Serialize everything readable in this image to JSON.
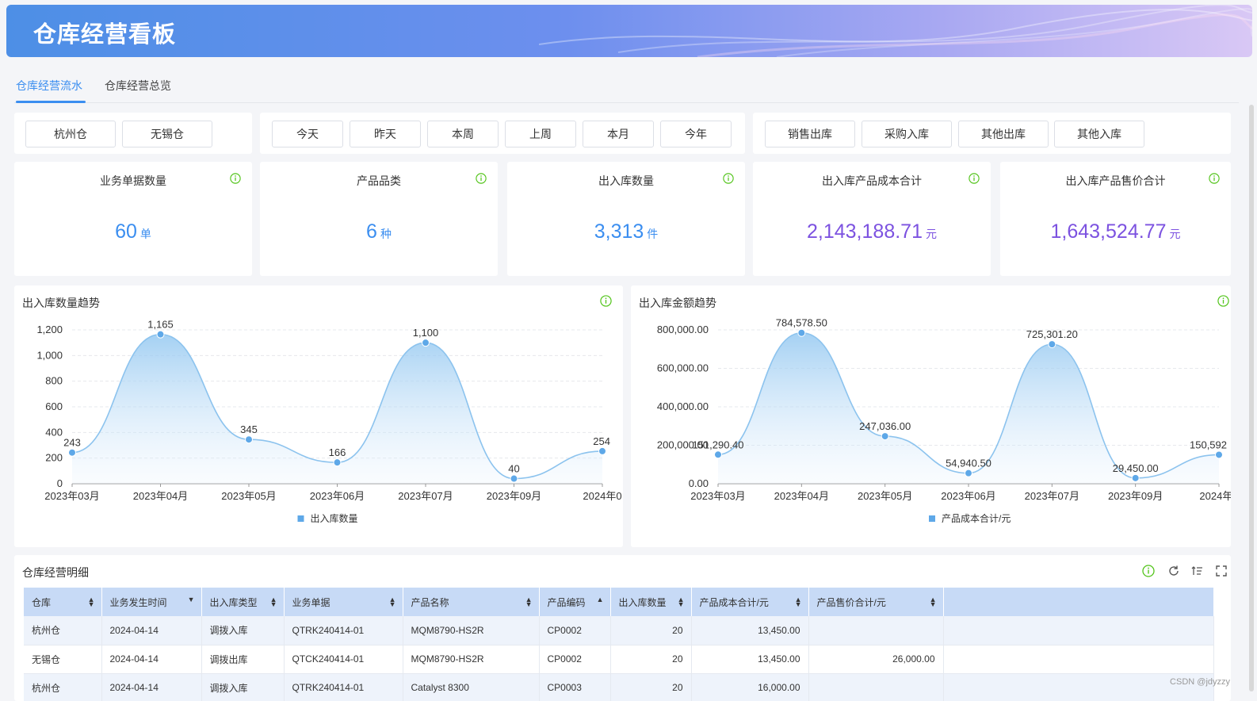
{
  "header": {
    "title": "仓库经营看板"
  },
  "tabs": [
    {
      "label": "仓库经营流水"
    },
    {
      "label": "仓库经营总览"
    }
  ],
  "filters": {
    "warehouses": [
      "杭州仓",
      "无锡仓"
    ],
    "periods": [
      "今天",
      "昨天",
      "本周",
      "上周",
      "本月",
      "今年"
    ],
    "types": [
      "销售出库",
      "采购入库",
      "其他出库",
      "其他入库"
    ]
  },
  "kpis": [
    {
      "label": "业务单据数量",
      "value": "60",
      "unit": "单",
      "color": "#3b8ef0"
    },
    {
      "label": "产品品类",
      "value": "6",
      "unit": "种",
      "color": "#3b8ef0"
    },
    {
      "label": "出入库数量",
      "value": "3,313",
      "unit": "件",
      "color": "#3b8ef0"
    },
    {
      "label": "出入库产品成本合计",
      "value": "2,143,188.71",
      "unit": "元",
      "color": "#7c52e0"
    },
    {
      "label": "出入库产品售价合计",
      "value": "1,643,524.77",
      "unit": "元",
      "color": "#7c52e0"
    }
  ],
  "chart_data": [
    {
      "type": "area",
      "title": "出入库数量趋势",
      "categories": [
        "2023年03月",
        "2023年04月",
        "2023年05月",
        "2023年06月",
        "2023年07月",
        "2023年09月",
        "2024年0"
      ],
      "series": [
        {
          "name": "出入库数量",
          "values": [
            243,
            1165,
            345,
            166,
            1100,
            40,
            254
          ],
          "labels": [
            "243",
            "1,165",
            "345",
            "166",
            "1,100",
            "40",
            "254"
          ]
        }
      ],
      "yticks": [
        "0",
        "200",
        "400",
        "600",
        "800",
        "1,000",
        "1,200"
      ],
      "ylim": [
        0,
        1200
      ],
      "grid": true
    },
    {
      "type": "area",
      "title": "出入库金额趋势",
      "categories": [
        "2023年03月",
        "2023年04月",
        "2023年05月",
        "2023年06月",
        "2023年07月",
        "2023年09月",
        "2024年0"
      ],
      "series": [
        {
          "name": "产品成本合计/元",
          "values": [
            151290.4,
            784578.5,
            247036.0,
            54940.5,
            725301.2,
            29450.0,
            150592
          ],
          "labels": [
            "151,290.40",
            "784,578.50",
            "247,036.00",
            "54,940.50",
            "725,301.20",
            "29,450.00",
            "150,592"
          ]
        }
      ],
      "yticks": [
        "0.00",
        "200,000.00",
        "400,000.00",
        "600,000.00",
        "800,000.00"
      ],
      "ylim": [
        0,
        800000
      ],
      "grid": true
    }
  ],
  "detail": {
    "title": "仓库经营明细",
    "columns": [
      "仓库",
      "业务发生时间",
      "出入库类型",
      "业务单据",
      "产品名称",
      "产品编码",
      "出入库数量",
      "产品成本合计/元",
      "产品售价合计/元"
    ],
    "rows": [
      [
        "杭州仓",
        "2024-04-14",
        "调拨入库",
        "QTRK240414-01",
        "MQM8790-HS2R",
        "CP0002",
        "20",
        "13,450.00",
        ""
      ],
      [
        "无锡仓",
        "2024-04-14",
        "调拨出库",
        "QTCK240414-01",
        "MQM8790-HS2R",
        "CP0002",
        "20",
        "13,450.00",
        "26,000.00"
      ],
      [
        "杭州仓",
        "2024-04-14",
        "调拨入库",
        "QTRK240414-01",
        "Catalyst 8300",
        "CP0003",
        "20",
        "16,000.00",
        ""
      ]
    ]
  },
  "watermark": "CSDN @jdyzzy",
  "colors": {
    "accent": "#3b8ef0",
    "purple": "#7c52e0",
    "info": "#52c41a",
    "line": "#8cc3ee",
    "point": "#5ea8e8"
  }
}
